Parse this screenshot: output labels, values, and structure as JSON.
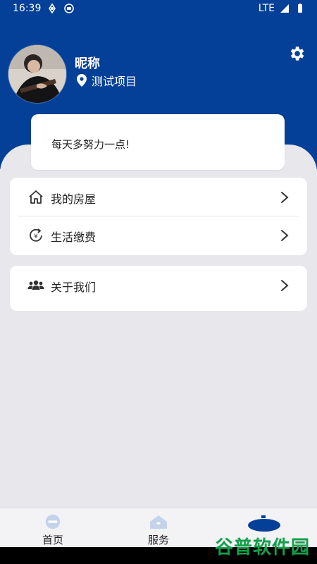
{
  "status_bar": {
    "time": "16:39",
    "network": "LTE"
  },
  "profile": {
    "nickname": "昵称",
    "project": "测试项目"
  },
  "motto": "每天多努力一点!",
  "menu": {
    "items": [
      {
        "label": "我的房屋",
        "icon": "house-icon"
      },
      {
        "label": "生活缴费",
        "icon": "payment-icon"
      },
      {
        "label": "关于我们",
        "icon": "users-icon"
      }
    ]
  },
  "bottom_nav": {
    "items": [
      {
        "label": "首页",
        "icon": "home-badge-icon"
      },
      {
        "label": "服务",
        "icon": "service-house-icon"
      },
      {
        "label": "",
        "icon": "profile-tab-icon",
        "active": true
      }
    ]
  },
  "watermark": "谷普软件园",
  "colors": {
    "header": "#043f98",
    "background": "#e7e7ec",
    "card": "#ffffff"
  }
}
